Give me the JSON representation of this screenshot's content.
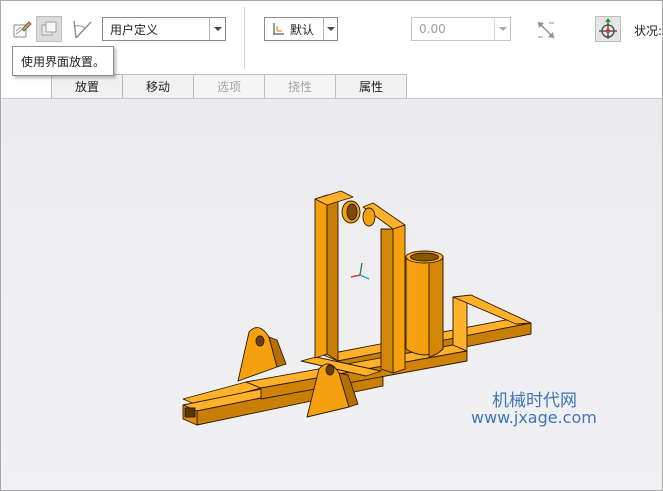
{
  "toolbar": {
    "edit_icon": "sketch-edit-icon",
    "drag_icon": "drag-components-icon",
    "angle_icon": "angle-offset-icon",
    "constraint_type": "用户定义",
    "offset_mode": "默认",
    "offset_value": "0.00",
    "flip_icon": "flip-direction-icon",
    "move_icon": "move-component-icon",
    "status_label": "状况:"
  },
  "tooltip": {
    "text": "使用界面放置。"
  },
  "tabs": [
    {
      "label": "放置",
      "enabled": true
    },
    {
      "label": "移动",
      "enabled": true
    },
    {
      "label": "选项",
      "enabled": false
    },
    {
      "label": "挠性",
      "enabled": false
    },
    {
      "label": "属性",
      "enabled": true
    }
  ],
  "viewport": {
    "model_color": "#f5a00f",
    "background": "#eeeef0"
  },
  "watermark": {
    "line1": "机械时代网",
    "line2": "www.jxage.com",
    "color": "#3e74b8"
  }
}
